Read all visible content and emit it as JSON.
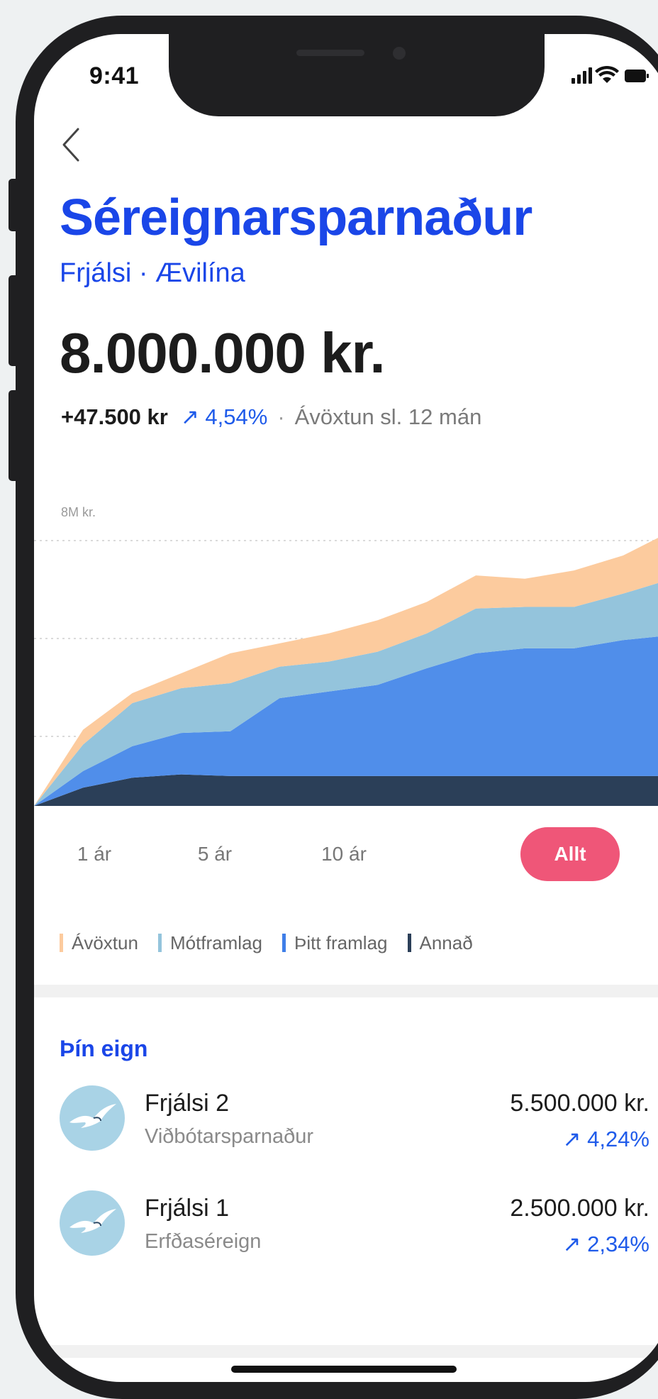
{
  "status": {
    "time": "9:41"
  },
  "header": {
    "title": "Séreignarsparnaður",
    "subtitle": "Frjálsi · Ævilína"
  },
  "balance": {
    "amount": "8.000.000 kr.",
    "change_abs": "+47.500 kr",
    "change_pct": "↗ 4,54%",
    "separator": "·",
    "change_label": "Ávöxtun sl. 12 mán"
  },
  "chart_data": {
    "type": "area",
    "stacked": true,
    "y_label": "8M kr.",
    "grid": true,
    "x": [
      0,
      1,
      2,
      3,
      4,
      5,
      6,
      7,
      8,
      9,
      10,
      11,
      12,
      13
    ],
    "series": [
      {
        "name": "Annað",
        "color": "#2b3f58",
        "values": [
          0,
          0.55,
          0.85,
          0.95,
          0.9,
          0.9,
          0.9,
          0.9,
          0.9,
          0.9,
          0.9,
          0.9,
          0.9,
          0.9
        ]
      },
      {
        "name": "Þitt framlag",
        "color": "#508eea",
        "values": [
          0,
          0.5,
          0.95,
          1.25,
          1.35,
          2.35,
          2.55,
          2.75,
          3.25,
          3.7,
          3.85,
          3.85,
          4.1,
          4.25
        ]
      },
      {
        "name": "Mótframlag",
        "color": "#94c4dc",
        "values": [
          0,
          0.8,
          1.3,
          1.35,
          1.45,
          0.95,
          0.9,
          1.0,
          1.05,
          1.35,
          1.25,
          1.25,
          1.4,
          1.7
        ]
      },
      {
        "name": "Ávöxtun",
        "color": "#fccb9e",
        "values": [
          0,
          0.45,
          0.3,
          0.45,
          0.9,
          0.7,
          0.85,
          0.95,
          0.95,
          1.0,
          0.85,
          1.1,
          1.15,
          1.45
        ]
      }
    ]
  },
  "ranges": [
    {
      "label": "1 ár",
      "active": false
    },
    {
      "label": "5 ár",
      "active": false
    },
    {
      "label": "10 ár",
      "active": false
    },
    {
      "label": "Allt",
      "active": true
    }
  ],
  "legend": [
    {
      "label": "Ávöxtun",
      "color": "#fccb9e"
    },
    {
      "label": "Mótframlag",
      "color": "#94c4dc"
    },
    {
      "label": "Þitt framlag",
      "color": "#3f7ee8"
    },
    {
      "label": "Annað",
      "color": "#2b3f58"
    }
  ],
  "holdings": {
    "title": "Þín eign",
    "items": [
      {
        "name": "Frjálsi 2",
        "type": "Viðbótarsparnaður",
        "value": "5.500.000 kr.",
        "pct": "↗ 4,24%"
      },
      {
        "name": "Frjálsi 1",
        "type": "Erfðaséreign",
        "value": "2.500.000 kr.",
        "pct": "↗ 2,34%"
      }
    ]
  },
  "accent_colors": {
    "primary": "#1a46e8",
    "active_pill": "#ef5678",
    "up": "#1f5bea"
  }
}
